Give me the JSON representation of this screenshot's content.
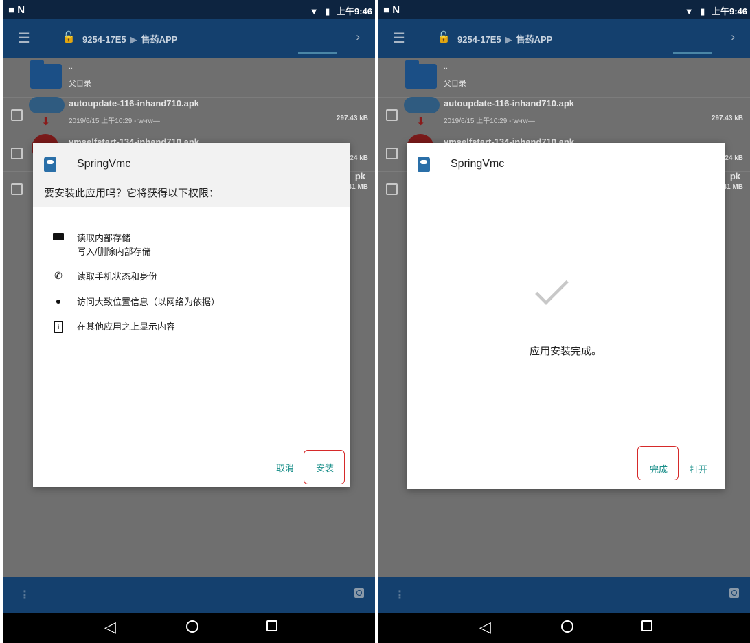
{
  "status_bar": {
    "left_icons": "■ N",
    "time": "上午9:46"
  },
  "app_bar": {
    "path_device": "9254-17E5",
    "path_separator": "▶",
    "path_folder": "售药APP",
    "forward": "›"
  },
  "file_list": {
    "parent": {
      "dots": "..",
      "label": "父目录"
    },
    "files": [
      {
        "name": "autoupdate-116-inhand710.apk",
        "meta": "2019/6/15 上午10:29  -rw-rw—",
        "size": "297.43 kB"
      },
      {
        "name": "vmselfstart-134-inhand710.apk",
        "size": ".24 kB"
      },
      {
        "name_fragment": "pk",
        "size": "41 MB"
      }
    ]
  },
  "install_dialog": {
    "app_name": "SpringVmc",
    "prompt": "要安装此应用吗？它将获得以下权限：",
    "permissions": [
      {
        "icon": "folder-icon",
        "title": "读取内部存储",
        "subtitle": "写入/删除内部存储"
      },
      {
        "icon": "phone-icon",
        "title": "读取手机状态和身份"
      },
      {
        "icon": "location-icon",
        "title": "访问大致位置信息（以网络为依据）"
      },
      {
        "icon": "info-icon",
        "title": "在其他应用之上显示内容"
      }
    ],
    "cancel_label": "取消",
    "install_label": "安装"
  },
  "complete_dialog": {
    "app_name": "SpringVmc",
    "message": "应用安装完成。",
    "done_label": "完成",
    "open_label": "打开"
  },
  "colors": {
    "accent": "#1a8f8a",
    "highlight": "#d62a2a",
    "app_bar": "#14406e",
    "status_bar": "#0d2440"
  }
}
